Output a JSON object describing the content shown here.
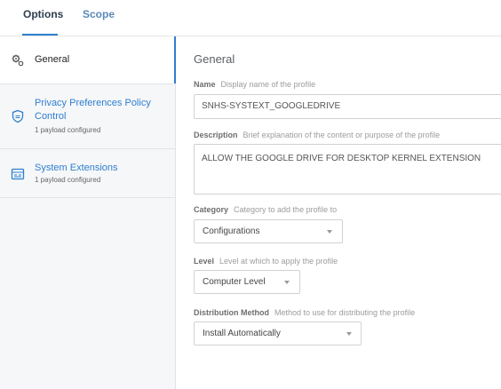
{
  "tabs": {
    "options": "Options",
    "scope": "Scope"
  },
  "sidebar": {
    "items": [
      {
        "label": "General",
        "icon": "gear-icon"
      },
      {
        "label": "Privacy Preferences Policy Control",
        "sub": "1 payload configured",
        "icon": "shield-icon"
      },
      {
        "label": "System Extensions",
        "sub": "1 payload configured",
        "icon": "extensions-icon"
      }
    ]
  },
  "general": {
    "title": "General",
    "name": {
      "label": "Name",
      "hint": "Display name of the profile",
      "value": "SNHS-SYSTEXT_GOOGLEDRIVE"
    },
    "description": {
      "label": "Description",
      "hint": "Brief explanation of the content or purpose of the profile",
      "value": "ALLOW THE GOOGLE DRIVE FOR DESKTOP KERNEL EXTENSION"
    },
    "category": {
      "label": "Category",
      "hint": "Category to add the profile to",
      "value": "Configurations"
    },
    "level": {
      "label": "Level",
      "hint": "Level at which to apply the profile",
      "value": "Computer Level"
    },
    "distribution": {
      "label": "Distribution Method",
      "hint": "Method to use for distributing the profile",
      "value": "Install Automatically"
    }
  },
  "colors": {
    "accent": "#2e7fd0",
    "sidebar_bg": "#f6f7f8"
  }
}
